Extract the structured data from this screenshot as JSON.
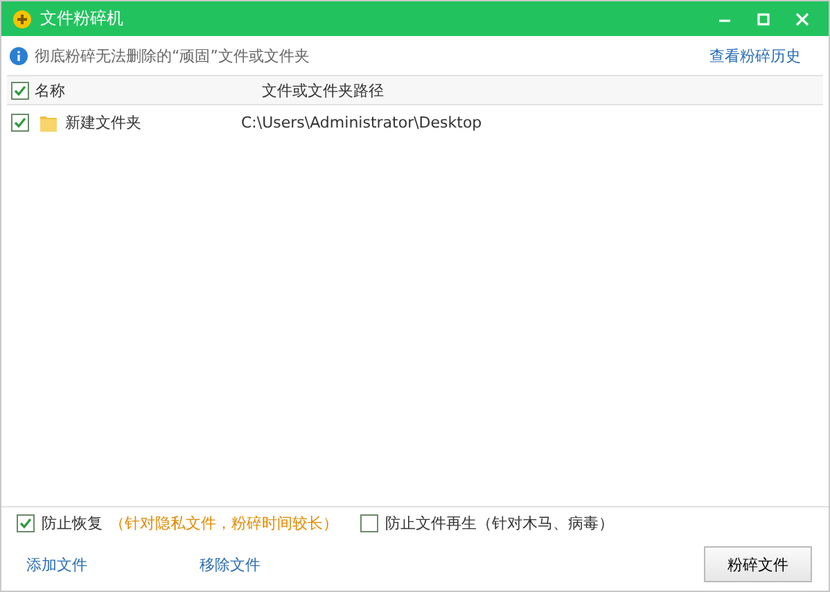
{
  "window": {
    "title": "文件粉碎机"
  },
  "info": {
    "text": "彻底粉碎无法删除的“顽固”文件或文件夹",
    "link": "查看粉碎历史"
  },
  "table": {
    "all_checked": true,
    "columns": [
      "名称",
      "文件或文件夹路径"
    ],
    "rows": [
      {
        "name": "新建文件夹",
        "path": "C:\\Users\\Administrator\\Desktop",
        "checked": true
      }
    ]
  },
  "options": [
    {
      "label": "防止恢复",
      "note": "（针对隐私文件，粉碎时间较长）",
      "checked": true
    },
    {
      "label": "防止文件再生（针对木马、病毒）",
      "checked": false
    }
  ],
  "actions": [
    "添加文件",
    "移除文件"
  ],
  "primary_button": "粉碎文件"
}
